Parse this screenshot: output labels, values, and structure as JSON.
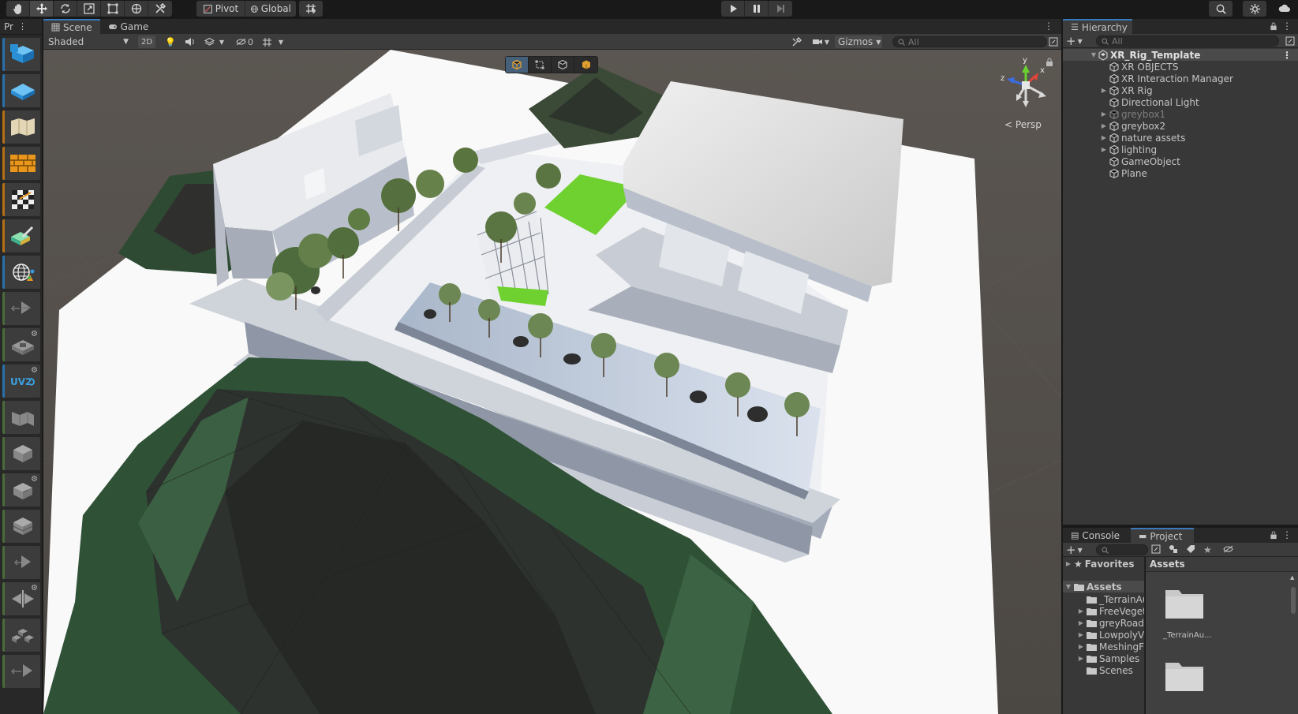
{
  "toolbar": {
    "pivot_label": "Pivot",
    "global_label": "Global"
  },
  "left_tools": {
    "tab_label": "Pr"
  },
  "scene": {
    "tabs": [
      {
        "label": "Scene"
      },
      {
        "label": "Game"
      }
    ],
    "shading_mode": "Shaded",
    "mode_2d_label": "2D",
    "hidden_count": "0",
    "gizmos_label": "Gizmos",
    "search_placeholder": "All",
    "persp_label": "Persp",
    "gizmo_axes": {
      "x": "x",
      "y": "y",
      "z": "z"
    }
  },
  "hierarchy": {
    "tab_label": "Hierarchy",
    "search_placeholder": "All",
    "root": "XR_Rig_Template",
    "items": [
      {
        "label": "XR OBJECTS"
      },
      {
        "label": "XR Interaction Manager"
      },
      {
        "label": "XR Rig"
      },
      {
        "label": "Directional Light"
      },
      {
        "label": "greybox1"
      },
      {
        "label": "greybox2"
      },
      {
        "label": "nature assets"
      },
      {
        "label": "lighting"
      },
      {
        "label": "GameObject"
      },
      {
        "label": "Plane"
      }
    ]
  },
  "project": {
    "tabs": [
      {
        "label": "Console"
      },
      {
        "label": "Project"
      }
    ],
    "favorites_label": "Favorites",
    "assets_label": "Assets",
    "assets_header": "Assets",
    "tree": [
      {
        "label": "_TerrainAu"
      },
      {
        "label": "FreeVegeta"
      },
      {
        "label": "greyRoadS"
      },
      {
        "label": "LowpolyVe"
      },
      {
        "label": "MeshingFe"
      },
      {
        "label": "Samples"
      },
      {
        "label": "Scenes"
      }
    ],
    "grid_items": [
      {
        "label": "_TerrainAu..."
      }
    ]
  },
  "colors": {
    "accent": "#3a79bb",
    "panel": "#383838",
    "toolbar": "#191919",
    "grass": "#6fd12f"
  }
}
